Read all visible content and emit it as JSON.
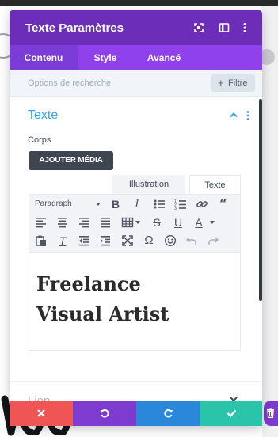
{
  "header": {
    "title": "Texte Paramètres"
  },
  "tabs": [
    {
      "label": "Contenu",
      "active": true
    },
    {
      "label": "Style",
      "active": false
    },
    {
      "label": "Avancé",
      "active": false
    }
  ],
  "search": {
    "placeholder": "Options de recherche",
    "filter_label": "Filtre"
  },
  "section": {
    "title": "Texte",
    "body_label": "Corps",
    "add_media_label": "AJOUTER MÉDIA",
    "editor_tabs": [
      "Illustration",
      "Texte"
    ],
    "format_select": "Paragraph",
    "content_lines": [
      "Freelance",
      "Visual Artist"
    ]
  },
  "collapsed_section": {
    "title": "Lien"
  },
  "colors": {
    "header": "#6c2eb9",
    "tabs": "#8f42ec",
    "accent_blue": "#2ea3f2",
    "cancel": "#ef5555",
    "undo": "#7e3bd0",
    "redo": "#2b87da",
    "save": "#29c4a9"
  },
  "icons": {
    "header": [
      "expand-icon",
      "split-view-icon",
      "more-vertical-icon"
    ],
    "footer": [
      "close-icon",
      "undo-icon",
      "redo-icon",
      "check-icon"
    ]
  }
}
